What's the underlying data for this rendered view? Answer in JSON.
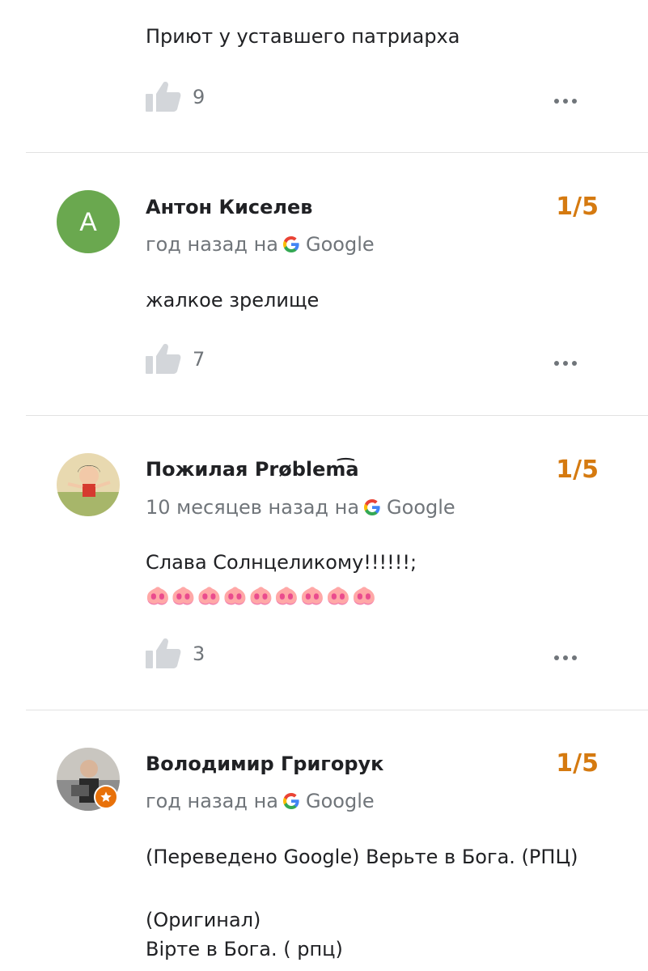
{
  "first_review": {
    "text": "Приют у  уставшего патриарха",
    "likes": "9"
  },
  "reviews": [
    {
      "avatar_letter": "А",
      "avatar_color": "#6aa84f",
      "author": "Антон Киселев",
      "rating": "1/5",
      "time": "год назад на",
      "source": "Google",
      "text_lines": [
        "жалкое зрелище"
      ],
      "likes": "7"
    },
    {
      "author": "Пожилая Prøblem͡a",
      "rating": "1/5",
      "time": "10 месяцев назад на",
      "source": "Google",
      "text_lines": [
        "Слава Солнцеликому!!!!!!;",
        "🐽🐽🐽🐽🐽🐽🐽🐽🐽"
      ],
      "likes": "3"
    },
    {
      "author": "Володимир Григорук",
      "rating": "1/5",
      "time": "год назад на",
      "source": "Google",
      "text_lines": [
        "(Переведено Google) Верьте в Бога. (РПЦ)",
        "",
        "(Оригинал)",
        "Вірте в Бога. ( рпц)"
      ],
      "badge_icon": "star-icon"
    }
  ],
  "colors": {
    "rating": "#d57a10",
    "meta": "#70757a",
    "icon": "#d3d6da"
  }
}
